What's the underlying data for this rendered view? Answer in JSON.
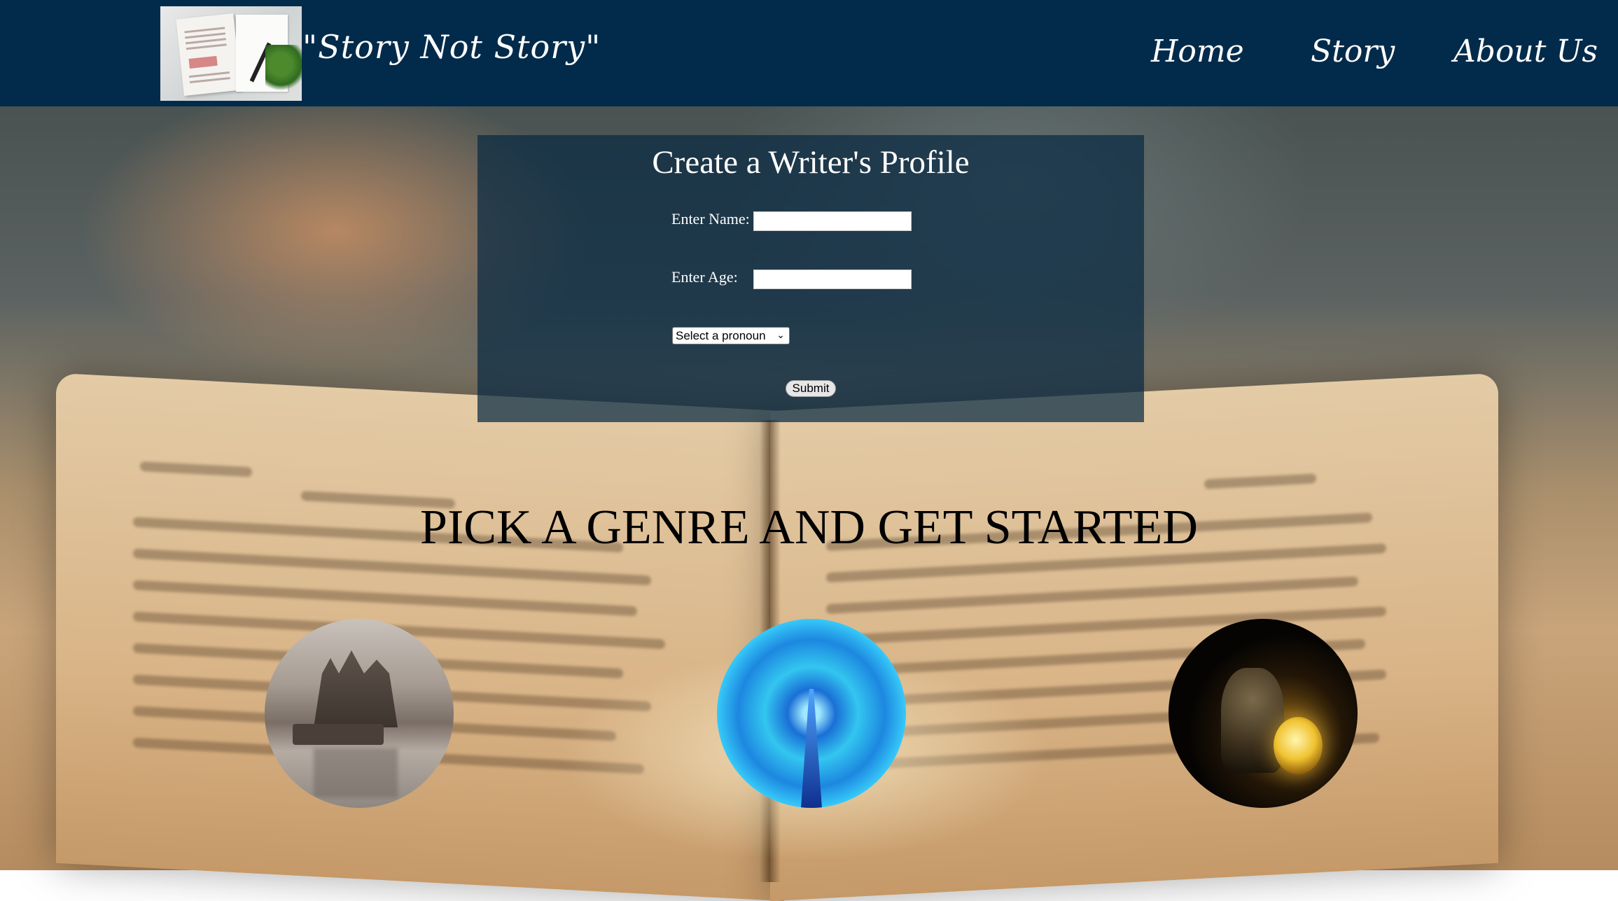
{
  "header": {
    "site_title": "\"Story Not Story\"",
    "nav": [
      {
        "label": "Home"
      },
      {
        "label": "Story"
      },
      {
        "label": "About Us"
      }
    ],
    "background_color": "#022b4b"
  },
  "profile_form": {
    "title": "Create a Writer's Profile",
    "name_label": "Enter Name:",
    "name_value": "",
    "age_label": "Enter Age:",
    "age_value": "",
    "pronoun_select": {
      "selected": "Select a pronoun"
    },
    "submit_label": "Submit"
  },
  "genre_section": {
    "heading": "PICK A GENRE AND GET STARTED",
    "genres": [
      {
        "icon": "castle-image"
      },
      {
        "icon": "futuristic-tunnel-image"
      },
      {
        "icon": "crystal-ball-image"
      }
    ]
  }
}
